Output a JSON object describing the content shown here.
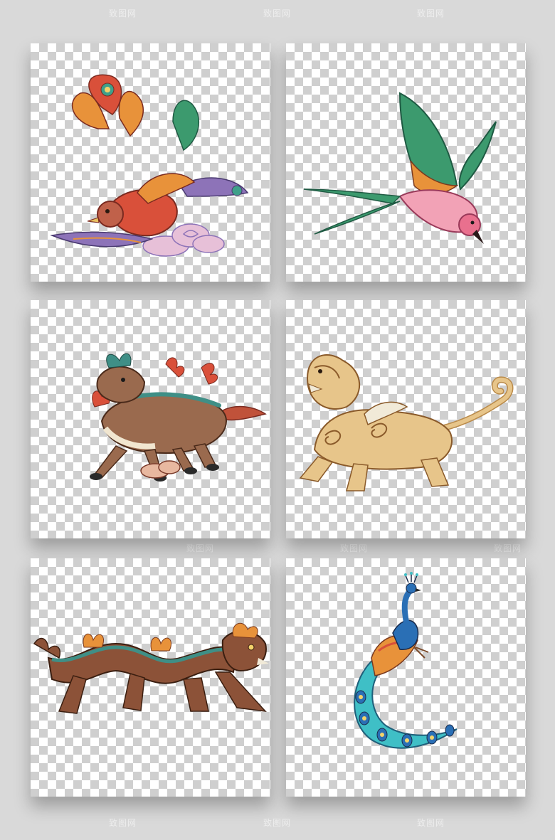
{
  "watermark": {
    "text": "致图网"
  },
  "cards": [
    {
      "subject": "phoenix-illustration"
    },
    {
      "subject": "swallow-illustration"
    },
    {
      "subject": "qilin-illustration"
    },
    {
      "subject": "pixiu-lion-illustration"
    },
    {
      "subject": "dragon-illustration"
    },
    {
      "subject": "peacock-illustration"
    }
  ],
  "colors": {
    "background": "#d9d9d9",
    "checker_light": "#ffffff",
    "checker_dark": "#cfcfcf",
    "phoenix_red": "#d9503a",
    "phoenix_orange": "#e8923a",
    "phoenix_purple": "#8d73b8",
    "swallow_green": "#3c9a6e",
    "swallow_pink": "#f2a2b6",
    "qilin_brown": "#9a6a4e",
    "qilin_teal": "#3f8f86",
    "lion_tan": "#e7c58a",
    "dragon_brown": "#8c5238",
    "peacock_blue": "#2a6fb5",
    "peacock_teal": "#3fbfc6"
  }
}
